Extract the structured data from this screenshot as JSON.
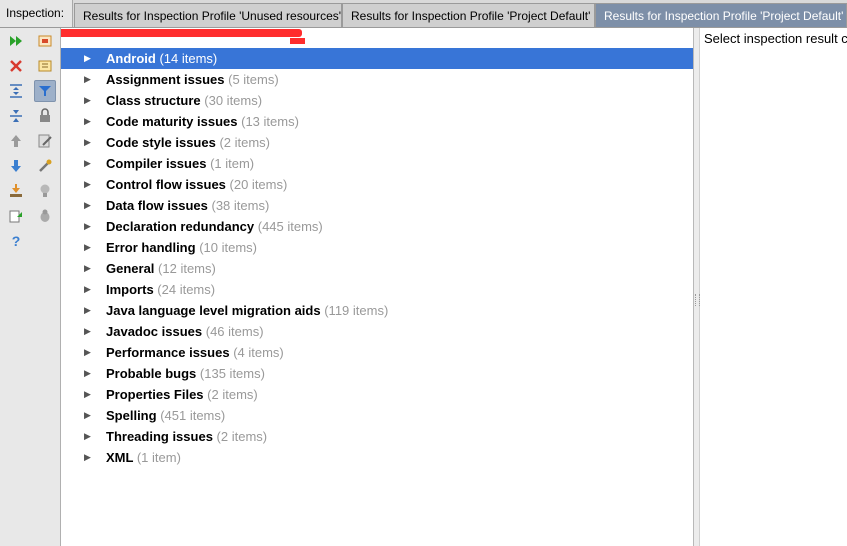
{
  "tabbar": {
    "label": "Inspection:",
    "tabs": [
      {
        "label": "Results for Inspection Profile 'Unused resources'"
      },
      {
        "label": "Results for Inspection Profile 'Project Default'"
      },
      {
        "label": "Results for Inspection Profile 'Project Default'"
      }
    ]
  },
  "toolbar": {
    "left_column": [
      "rerun-icon",
      "close-icon",
      "expand-all-icon",
      "collapse-all-icon",
      "previous-icon",
      "next-icon",
      "export-icon",
      "edit-settings-icon",
      "help-icon"
    ],
    "right_column": [
      "run-profile-icon",
      "suppress-icon",
      "filter-icon",
      "locked-icon",
      "edit-inspection-icon",
      "quick-fix-icon",
      "bulb-icon",
      "debug-icon"
    ]
  },
  "tree": {
    "items": [
      {
        "name": "Android",
        "count": "(14 items)"
      },
      {
        "name": "Assignment issues",
        "count": "(5 items)"
      },
      {
        "name": "Class structure",
        "count": "(30 items)"
      },
      {
        "name": "Code maturity issues",
        "count": "(13 items)"
      },
      {
        "name": "Code style issues",
        "count": "(2 items)"
      },
      {
        "name": "Compiler issues",
        "count": "(1 item)"
      },
      {
        "name": "Control flow issues",
        "count": "(20 items)"
      },
      {
        "name": "Data flow issues",
        "count": "(38 items)"
      },
      {
        "name": "Declaration redundancy",
        "count": "(445 items)"
      },
      {
        "name": "Error handling",
        "count": "(10 items)"
      },
      {
        "name": "General",
        "count": "(12 items)"
      },
      {
        "name": "Imports",
        "count": "(24 items)"
      },
      {
        "name": "Java language level migration aids",
        "count": "(119 items)"
      },
      {
        "name": "Javadoc issues",
        "count": "(46 items)"
      },
      {
        "name": "Performance issues",
        "count": "(4 items)"
      },
      {
        "name": "Probable bugs",
        "count": "(135 items)"
      },
      {
        "name": "Properties Files",
        "count": "(2 items)"
      },
      {
        "name": "Spelling",
        "count": "(451 items)"
      },
      {
        "name": "Threading issues",
        "count": "(2 items)"
      },
      {
        "name": "XML",
        "count": "(1 item)"
      }
    ],
    "expander": "▶"
  },
  "details": {
    "message": "Select inspection result c"
  },
  "colors": {
    "selection": "#3875d7",
    "active_tab": "#7d8fa8",
    "count_text": "#999999"
  }
}
